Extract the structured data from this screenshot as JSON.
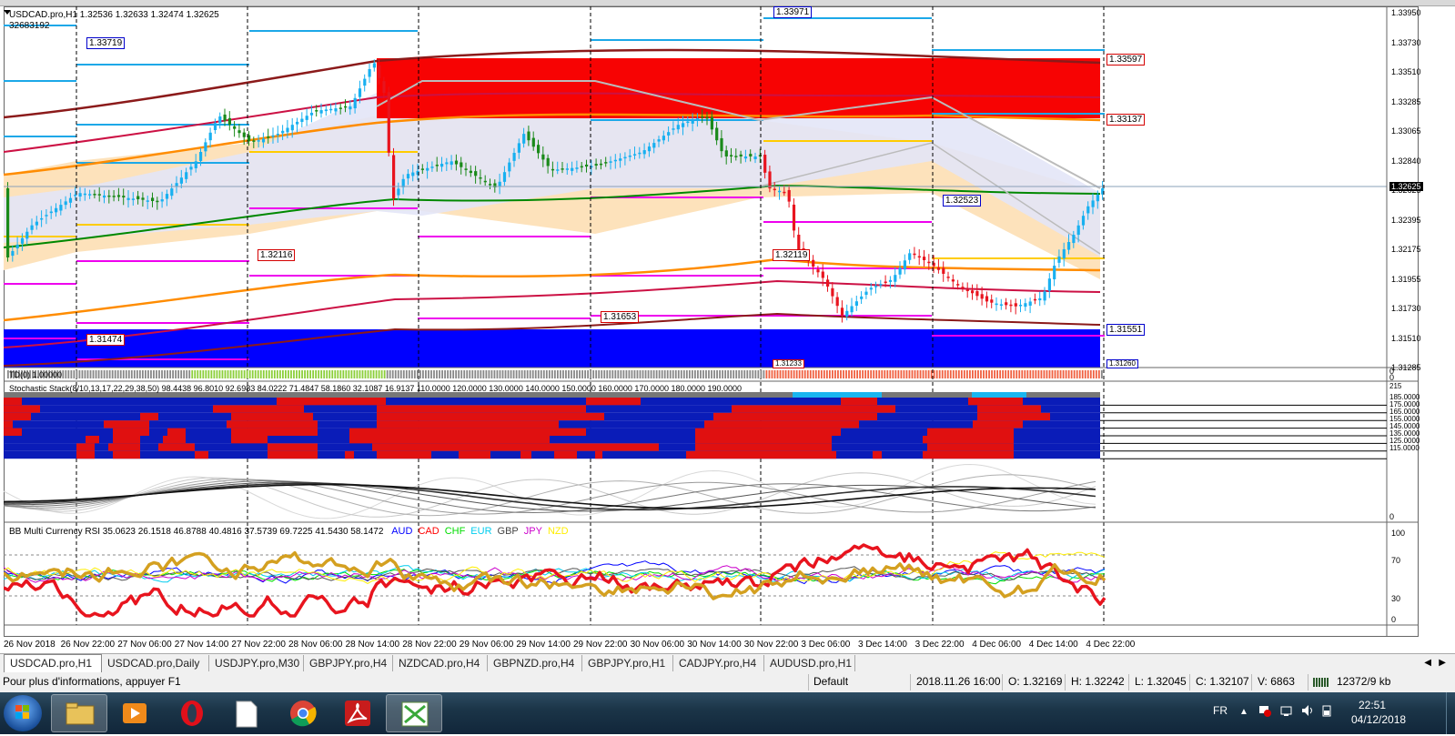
{
  "main_chart": {
    "symbol_info": "USDCAD.pro,H1  1.32536 1.32633 1.32474 1.32625",
    "sub_info": "32683192",
    "price_axis": [
      "1.33950",
      "1.33730",
      "1.33510",
      "1.33285",
      "1.33065",
      "1.32840",
      "1.32625",
      "1.32395",
      "1.32175",
      "1.31955",
      "1.31730",
      "1.31510",
      "1.31285"
    ],
    "current_price": "1.32625",
    "level_tags": [
      {
        "text": "1.33719",
        "color": "#0000cc"
      },
      {
        "text": "1.33971",
        "color": "#0000cc"
      },
      {
        "text": "1.33597",
        "color": "#d40000"
      },
      {
        "text": "1.33137",
        "color": "#d40000"
      },
      {
        "text": "1.32523",
        "color": "#0000cc"
      },
      {
        "text": "1.32116",
        "color": "#d40000"
      },
      {
        "text": "1.32119",
        "color": "#d40000"
      },
      {
        "text": "1.31653",
        "color": "#d40000"
      },
      {
        "text": "1.31551",
        "color": "#0000cc"
      },
      {
        "text": "1.31474",
        "color": "#d40000"
      },
      {
        "text": "1.31260",
        "color": "#0000cc"
      },
      {
        "text": "1.31233",
        "color": "#d40000"
      }
    ]
  },
  "td_panel": {
    "label": "TD(0) 1.00000",
    "axis_top": "0",
    "axis_bottom": "0"
  },
  "stoch_panel": {
    "title": "Stochastic Stack(8/10,13,17,22,29,38,50) 98.4438 96.8010 92.6983 84.0222 71.4847 58.1860 32.1087 16.9137 110.0000 120.0000 130.0000 140.0000 150.0000 160.0000 170.0000 180.0000 190.0000",
    "axis": [
      "215",
      "185.0000",
      "175.0000",
      "165.0000",
      "155.0000",
      "145.0000",
      "135.0000",
      "125.0000",
      "115.0000"
    ],
    "axis_bottom": "0"
  },
  "rsi_panel": {
    "title": "BB Multi Currency RSI 35.0623 26.1518 46.8788 40.4816 37.5739 69.7225 41.5430 58.1472",
    "currencies": [
      {
        "name": "AUD",
        "color": "#0000ff"
      },
      {
        "name": "CAD",
        "color": "#ff0000"
      },
      {
        "name": "CHF",
        "color": "#00dd00"
      },
      {
        "name": "EUR",
        "color": "#00ccee"
      },
      {
        "name": "GBP",
        "color": "#444444"
      },
      {
        "name": "JPY",
        "color": "#cc00cc"
      },
      {
        "name": "NZD",
        "color": "#ffee00"
      }
    ],
    "axis": [
      "100",
      "70",
      "30",
      "0"
    ]
  },
  "time_axis": [
    "26 Nov 2018",
    "26 Nov 22:00",
    "27 Nov 06:00",
    "27 Nov 14:00",
    "27 Nov 22:00",
    "28 Nov 06:00",
    "28 Nov 14:00",
    "28 Nov 22:00",
    "29 Nov 06:00",
    "29 Nov 14:00",
    "29 Nov 22:00",
    "30 Nov 06:00",
    "30 Nov 14:00",
    "30 Nov 22:00",
    "3 Dec 06:00",
    "3 Dec 14:00",
    "3 Dec 22:00",
    "4 Dec 06:00",
    "4 Dec 14:00",
    "4 Dec 22:00"
  ],
  "tabs": [
    "USDCAD.pro,H1",
    "USDCAD.pro,Daily",
    "USDJPY.pro,M30",
    "GBPJPY.pro,H4",
    "NZDCAD.pro,H4",
    "GBPNZD.pro,H4",
    "GBPJPY.pro,H1",
    "CADJPY.pro,H4",
    "AUDUSD.pro,H1"
  ],
  "status": {
    "help": "Pour plus d'informations, appuyer F1",
    "profile": "Default",
    "datetime": "2018.11.26 16:00",
    "open": "O: 1.32169",
    "high": "H: 1.32242",
    "low": "L: 1.32045",
    "close": "C: 1.32107",
    "volume": "V: 6863",
    "traffic": "12372/9 kb"
  },
  "taskbar": {
    "lang": "FR",
    "time": "22:51",
    "date": "04/12/2018"
  }
}
